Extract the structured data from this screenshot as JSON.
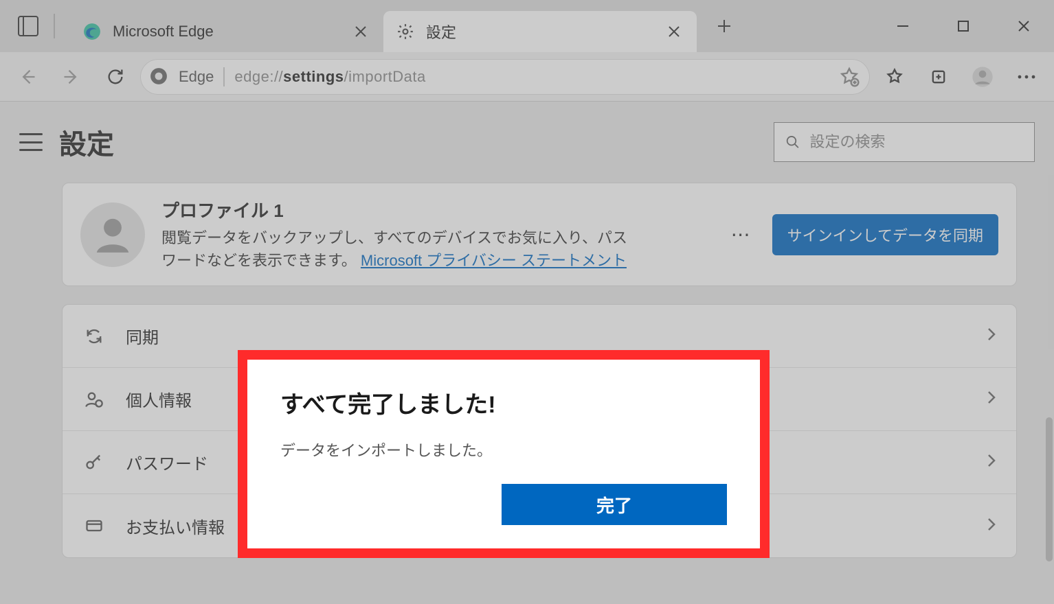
{
  "tabs": [
    {
      "title": "Microsoft Edge"
    },
    {
      "title": "設定"
    }
  ],
  "addressbar": {
    "prefix": "Edge",
    "url_dim_pre": "edge://",
    "url_bold": "settings",
    "url_dim_post": "/importData"
  },
  "page": {
    "title": "設定",
    "search_placeholder": "設定の検索"
  },
  "profile": {
    "name": "プロファイル 1",
    "desc_pre": "閲覧データをバックアップし、すべてのデバイスでお気に入り、パスワードなどを表示できます。 ",
    "link": "Microsoft プライバシー ステートメント",
    "signin_btn": "サインインしてデータを同期"
  },
  "rows": {
    "sync": "同期",
    "personal": "個人情報",
    "password": "パスワード",
    "payment": "お支払い情報"
  },
  "dialog": {
    "title": "すべて完了しました!",
    "body": "データをインポートしました。",
    "done": "完了"
  }
}
